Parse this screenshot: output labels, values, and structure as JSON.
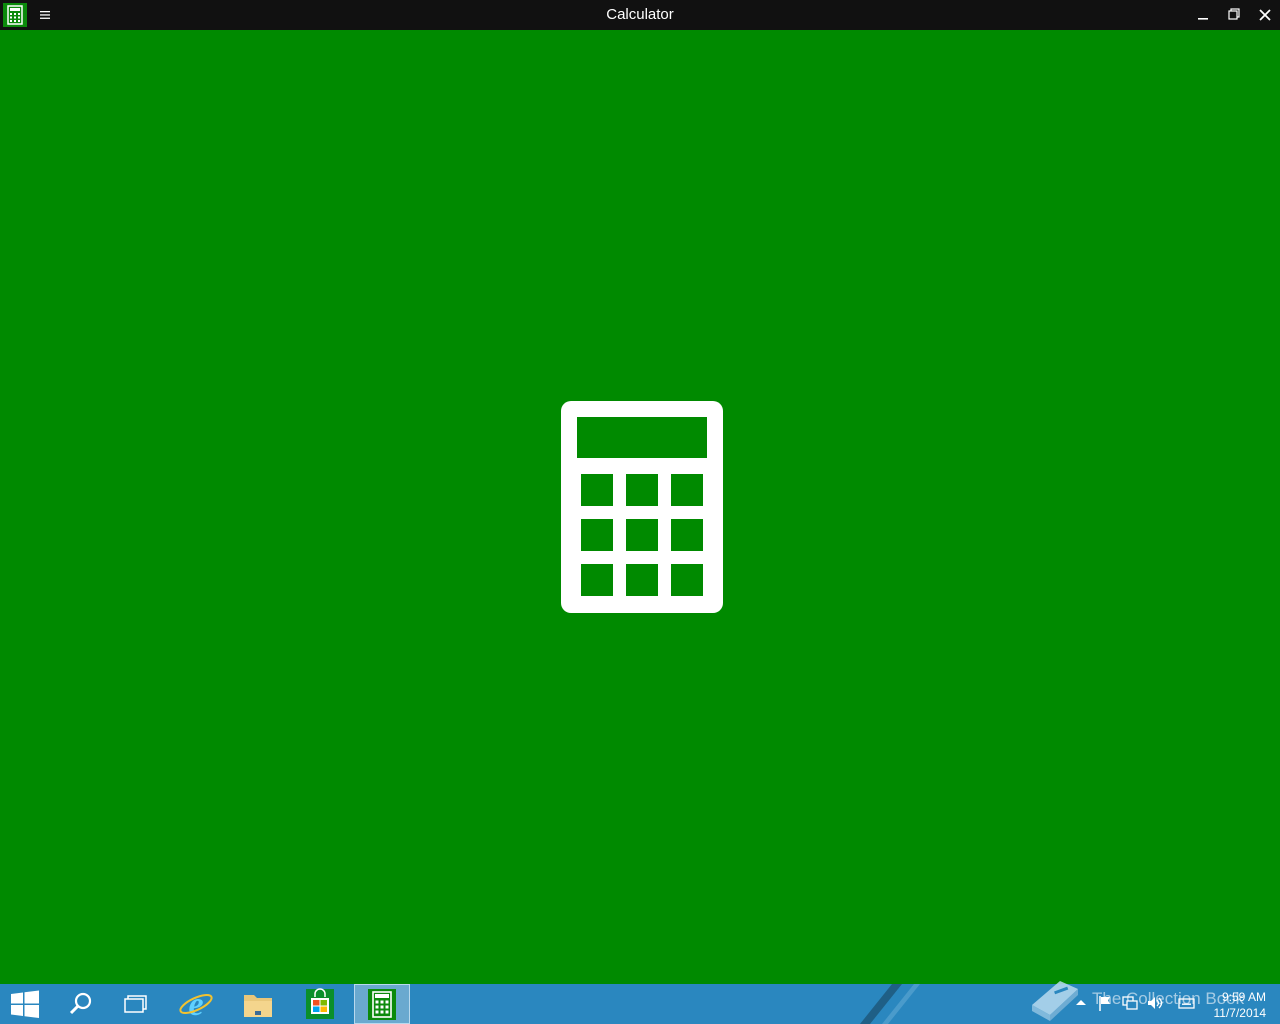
{
  "window": {
    "title": "Calculator",
    "icons": {
      "app": "calculator-icon",
      "menu": "hamburger-menu-icon",
      "minimize": "minimize-icon",
      "maximize": "restore-icon",
      "close": "close-icon"
    }
  },
  "splash": {
    "icon": "calculator-icon",
    "background_color": "#008a00"
  },
  "taskbar": {
    "items": [
      {
        "name": "start-button",
        "icon": "windows-logo-icon"
      },
      {
        "name": "search-button",
        "icon": "search-icon"
      },
      {
        "name": "task-view-button",
        "icon": "task-view-icon"
      },
      {
        "name": "internet-explorer-button",
        "icon": "internet-explorer-icon"
      },
      {
        "name": "file-explorer-button",
        "icon": "folder-icon"
      },
      {
        "name": "store-button",
        "icon": "store-bag-icon"
      },
      {
        "name": "calculator-taskbar-button",
        "icon": "calculator-icon",
        "active": true
      }
    ],
    "tray": {
      "watermark_text": "The Collection Book",
      "icons": [
        "chevron-up-icon",
        "flag-icon",
        "network-icon",
        "speaker-icon",
        "keyboard-icon"
      ],
      "time": "9:59 AM",
      "date": "11/7/2014"
    },
    "background_color": "#2a87bf"
  }
}
